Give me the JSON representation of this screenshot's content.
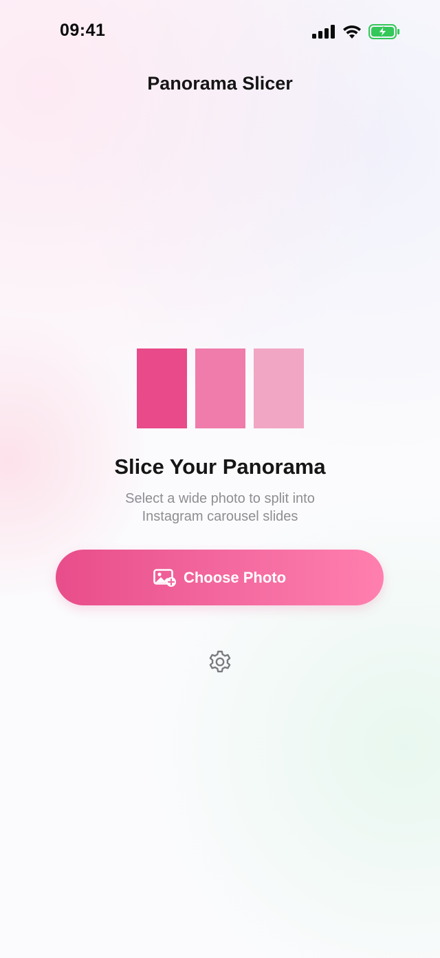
{
  "status_bar": {
    "time": "09:41"
  },
  "nav": {
    "title": "Panorama Slicer"
  },
  "hero": {
    "title": "Slice Your Panorama",
    "subtitle_line1": "Select a wide photo to split into",
    "subtitle_line2": "Instagram carousel slides",
    "slice_colors": [
      "#e84a8a",
      "#ef7cab",
      "#f1a6c3"
    ]
  },
  "actions": {
    "choose_photo_label": "Choose Photo",
    "choose_photo_icon": "photo-add-icon",
    "settings_icon": "gear-icon"
  },
  "colors": {
    "accent": "#e84d8a",
    "accent_end": "#ff7fae",
    "battery": "#34c759"
  }
}
